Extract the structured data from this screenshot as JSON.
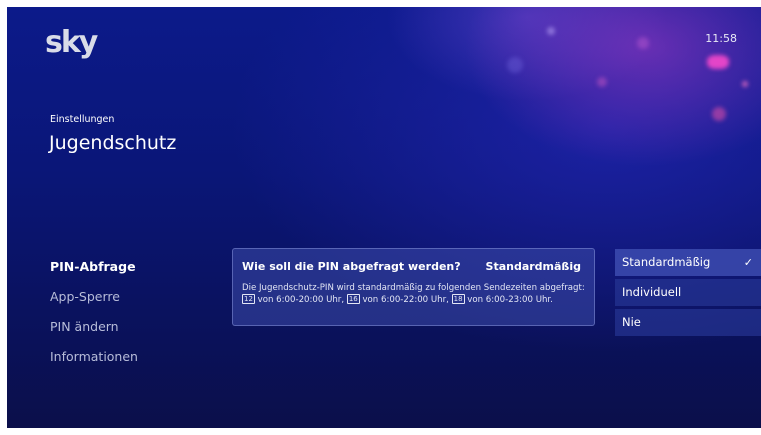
{
  "header": {
    "logo": "sky",
    "clock": "11:58"
  },
  "breadcrumb": "Einstellungen",
  "page_title": "Jugendschutz",
  "menu": {
    "items": [
      {
        "label": "PIN-Abfrage"
      },
      {
        "label": "App-Sperre"
      },
      {
        "label": "PIN ändern"
      },
      {
        "label": "Informationen"
      }
    ],
    "active_index": 0
  },
  "info_panel": {
    "question": "Wie soll die PIN abgefragt werden?",
    "current_value": "Standardmäßig",
    "description_parts": {
      "p1": "Die Jugendschutz-PIN wird standardmäßig zu folgenden Sendezeiten abgefragt: ",
      "age1": "12",
      "p2": " von 6:00-20:00 Uhr, ",
      "age2": "16",
      "p3": " von 6:00-22:00 Uhr, ",
      "age3": "18",
      "p4": " von 6:00-23:00 Uhr."
    }
  },
  "options": {
    "items": [
      {
        "label": "Standardmäßig"
      },
      {
        "label": "Individuell"
      },
      {
        "label": "Nie"
      }
    ],
    "selected_index": 0,
    "check_glyph": "✓"
  },
  "colors": {
    "background_top": "#0c1a8a",
    "background_bottom": "#0b0f4a",
    "accent_pink": "#e040c0"
  }
}
